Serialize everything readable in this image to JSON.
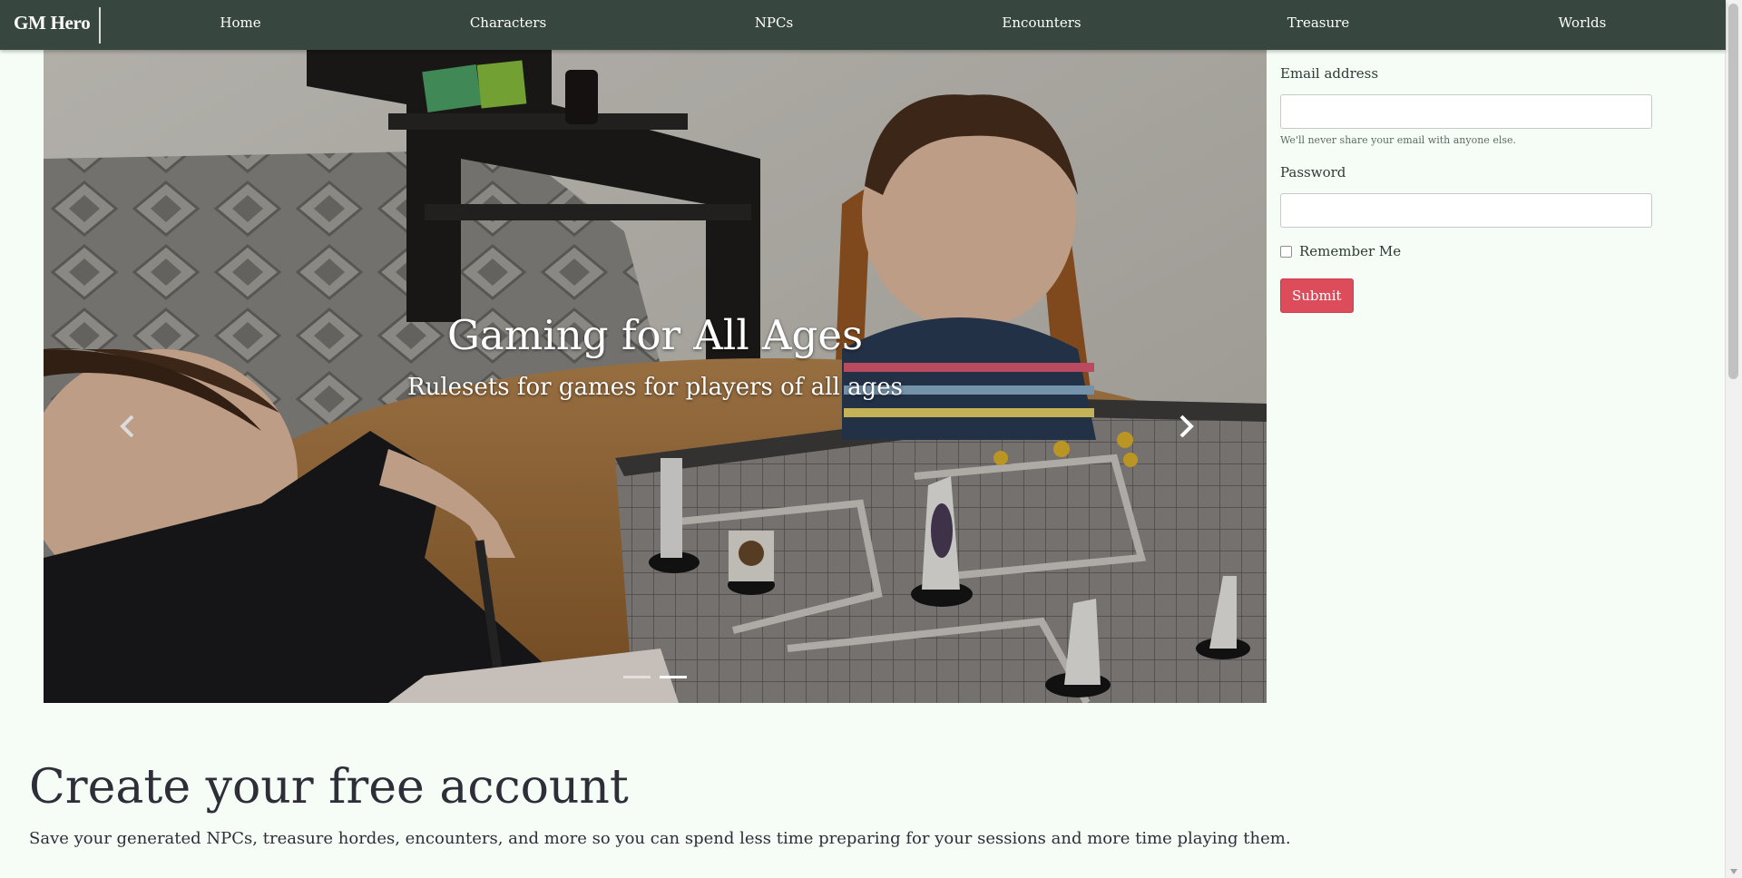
{
  "navbar": {
    "brand": "GM Hero",
    "items": [
      {
        "label": "Home"
      },
      {
        "label": "Characters"
      },
      {
        "label": "NPCs"
      },
      {
        "label": "Encounters"
      },
      {
        "label": "Treasure"
      },
      {
        "label": "Worlds"
      }
    ]
  },
  "carousel": {
    "title": "Gaming for All Ages",
    "subtitle": "Rulesets for games for players of all ages",
    "prev_icon": "chevron-left-icon",
    "next_icon": "chevron-right-icon",
    "slide_count": 2,
    "active_slide": 2
  },
  "login": {
    "email_label": "Email address",
    "email_value": "",
    "email_help": "We'll never share your email with anyone else.",
    "password_label": "Password",
    "password_value": "",
    "remember_label": "Remember Me",
    "remember_checked": false,
    "submit_label": "Submit"
  },
  "signup": {
    "title": "Create your free account",
    "text": "Save your generated NPCs, treasure hordes, encounters, and more so you can spend less time preparing for your sessions and more time playing them."
  },
  "colors": {
    "navbar_bg": "#37473f",
    "page_bg": "#f6fdf6",
    "submit_bg": "#dc4c5b"
  }
}
